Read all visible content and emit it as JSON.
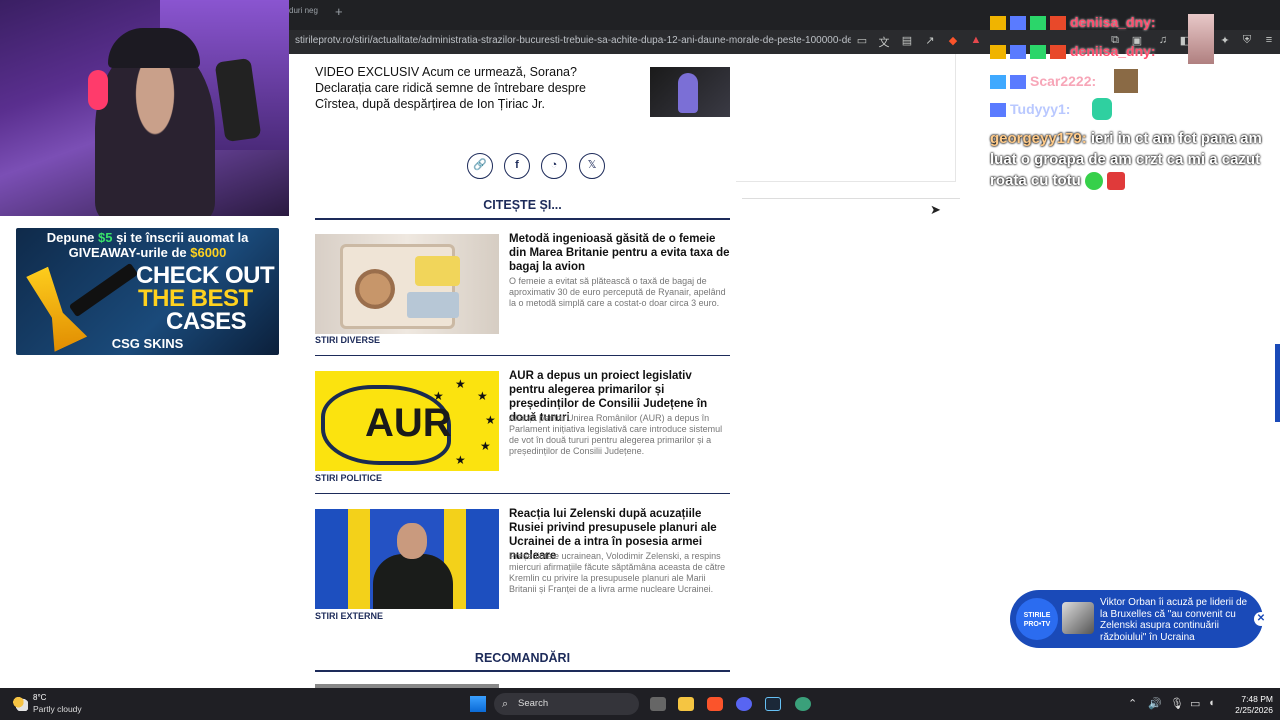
{
  "browser": {
    "tab_title": "duri neg",
    "new_tab": "+",
    "url": "stirileprotv.ro/stiri/actualitate/administratia-strazilor-bucuresti-trebuie-sa-achite-dupa-12-ani-daune-morale-de-peste-100000-de-le..."
  },
  "ad": {
    "line1_prefix": "Depune ",
    "line1_amount": "$5",
    "line1_suffix": " și te înscrii auomat la",
    "line2_prefix": "GIVEAWAY-urile de ",
    "line2_amount": "$6000",
    "cta_line1": "CHECK OUT",
    "cta_line2": "THE BEST",
    "cta_line3": "CASES",
    "brand": "CSG SKINS"
  },
  "article": {
    "video_title": "VIDEO EXCLUSIV Acum ce urmează, Sorana? Declarația care ridică semne de întrebare despre Cîrstea, după despărțirea de Ion Țiriac Jr.",
    "share_icons": [
      "link",
      "facebook",
      "whatsapp",
      "x"
    ],
    "share_glyphs": [
      "🔗",
      "f",
      "◔",
      "𝕏"
    ],
    "read_also_heading": "CITEȘTE ȘI...",
    "recommended_heading": "RECOMANDĂRI",
    "cards": [
      {
        "title": "Metodă ingenioasă găsită de o femeie din Marea Britanie pentru a evita taxa de bagaj la avion",
        "desc": "O femeie a evitat să plătească o taxă de bagaj de aproximativ 30 de euro percepută de Ryanair, apelând la o metodă simplă care a costat-o doar circa 3 euro.",
        "category": "STIRI DIVERSE"
      },
      {
        "title": "AUR a depus un proiect legislativ pentru alegerea primarilor și președinților de Consilii Județene în două tururi",
        "desc": "Alianța pentru Unirea Românilor (AUR) a depus în Parlament inițiativa legislativă care introduce sistemul de vot în două tururi pentru alegerea primarilor și a președinților de Consilii Județene.",
        "category": "STIRI POLITICE",
        "image_text": "AUR"
      },
      {
        "title": "Reacția lui Zelenski după acuzațiile Rusiei privind presupusele planuri ale Ucrainei de a intra în posesia armei nucleare",
        "desc": "Președintele ucrainean, Volodimir Zelenski, a respins miercuri afirmațiile făcute săptămâna aceasta de către Kremlin cu privire la presupusele planuri ale Marii Britanii și Franței de a livra arme nucleare Ucrainei.",
        "category": "STIRI EXTERNE"
      }
    ]
  },
  "chat": {
    "lines": [
      {
        "name": "deniisa_dny:"
      },
      {
        "name": "deniisa_dny:"
      },
      {
        "name": "Scar2222:"
      },
      {
        "name": "Tudyyy1:"
      }
    ],
    "message": {
      "name": "georgeyy179:",
      "text": " ieri in ct am fct pana am luat o groapa de am crzt ca mi a cazut roata cu totu"
    }
  },
  "toast": {
    "logo": "STIRILE PRO•TV",
    "text": "Viktor Orban îi acuză pe liderii de la Bruxelles că \"au convenit cu Zelenski asupra continuării războiului\" în Ucraina",
    "close": "✕"
  },
  "taskbar": {
    "temperature": "8°C",
    "condition": "Partly cloudy",
    "search": "Search",
    "time": "7:48 PM",
    "date": "2/25/2026"
  },
  "colors": {
    "accent": "#1d2b5a",
    "toast_bg": "#1a4ab8",
    "chat_name": "#ff4d6d"
  }
}
